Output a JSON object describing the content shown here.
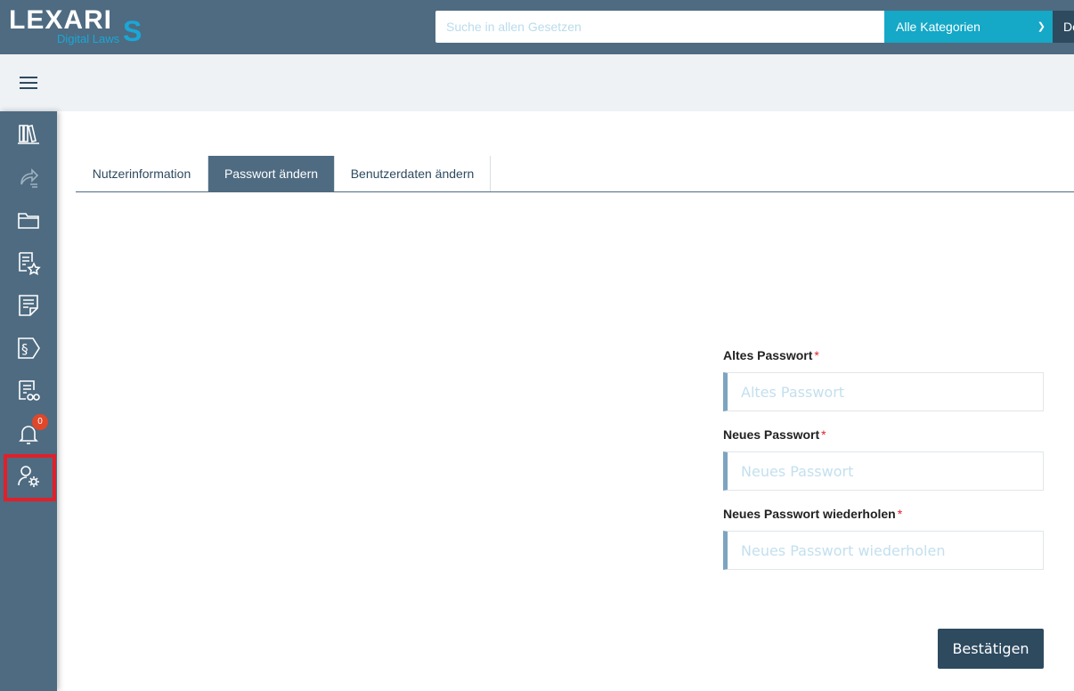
{
  "header": {
    "logo_main": "LEXARI",
    "logo_s": "S",
    "logo_sub": "Digital Laws",
    "search_placeholder": "Suche in allen Gesetzen",
    "category_label": "Alle Kategorien",
    "language_label": "De"
  },
  "sidebar": {
    "icons": [
      "library-icon",
      "share-doc-icon",
      "folder-icon",
      "favorite-doc-icon",
      "notes-icon",
      "paragraph-tag-icon",
      "document-review-icon",
      "bell-icon",
      "user-settings-icon"
    ],
    "notification_count": "0"
  },
  "tabs": [
    {
      "label": "Nutzerinformation",
      "active": false
    },
    {
      "label": "Passwort ändern",
      "active": true
    },
    {
      "label": "Benutzerdaten ändern",
      "active": false
    }
  ],
  "form": {
    "old_password": {
      "label": "Altes Passwort",
      "required_mark": "*",
      "placeholder": "Altes Passwort"
    },
    "new_password": {
      "label": "Neues Passwort",
      "required_mark": "*",
      "placeholder": "Neues Passwort"
    },
    "repeat_password": {
      "label": "Neues Passwort wiederholen",
      "required_mark": "*",
      "placeholder": "Neues Passwort wiederholen"
    },
    "submit_label": "Bestätigen"
  },
  "colors": {
    "primary": "#4e6b81",
    "dark": "#2d4a5f",
    "accent": "#15a8c7",
    "required": "#e0202a"
  }
}
